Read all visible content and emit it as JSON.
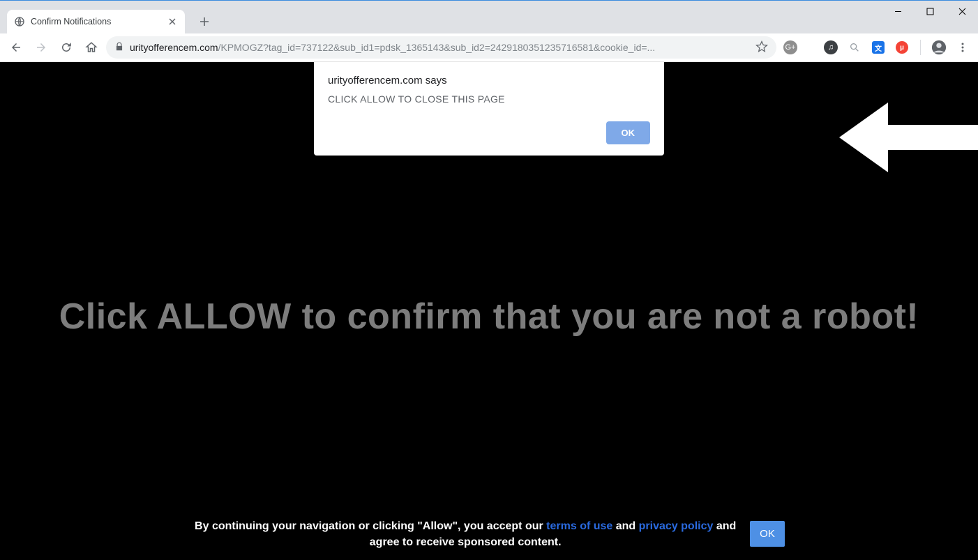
{
  "window": {
    "tab_title": "Confirm Notifications"
  },
  "url": {
    "host": "urityofferencem.com",
    "path": "/KPMOGZ?tag_id=737122&sub_id1=pdsk_1365143&sub_id2=2429180351235716581&cookie_id=..."
  },
  "alert": {
    "origin": "urityofferencem.com says",
    "message": "CLICK ALLOW TO CLOSE THIS PAGE",
    "ok_label": "OK"
  },
  "page": {
    "headline": "Click ALLOW to confirm that you are not a robot!",
    "consent_prefix": "By continuing your navigation or clicking \"Allow\", you accept our ",
    "terms_label": "terms of use",
    "and_label": " and ",
    "privacy_label": "privacy policy",
    "consent_suffix": " and agree to receive sponsored content.",
    "consent_ok_label": "OK"
  }
}
